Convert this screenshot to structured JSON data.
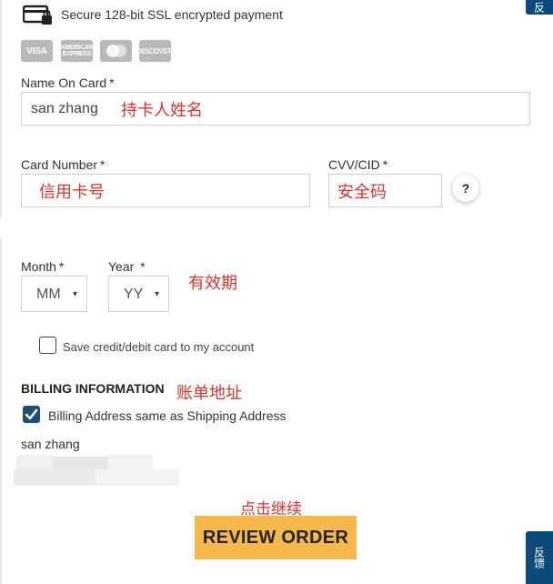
{
  "secure": {
    "text": "Secure 128-bit SSL encrypted payment"
  },
  "cards": {
    "visa": "VISA",
    "amex": "AMERICAN EXPRESS",
    "discover": "DISCOVER"
  },
  "name_on_card": {
    "label": "Name On Card",
    "required": "*",
    "value": "san zhang",
    "annotation": "持卡人姓名"
  },
  "card_number": {
    "label": "Card Number",
    "required": "*",
    "annotation": "信用卡号"
  },
  "cvv": {
    "label": "CVV/CID",
    "required": "*",
    "annotation": "安全码",
    "help": "?"
  },
  "month": {
    "label": "Month",
    "required": "*",
    "value": "MM",
    "caret": "▾"
  },
  "year": {
    "label": "Year",
    "required": "*",
    "value": "YY",
    "caret": "▾"
  },
  "expiry_annotation": "有效期",
  "save_card": {
    "label": "Save credit/debit card to my account",
    "checked": false
  },
  "billing": {
    "heading": "BILLING INFORMATION",
    "annotation": "账单地址",
    "same_as_shipping_label": "Billing Address same as Shipping Address",
    "same_as_shipping_checked": true,
    "name": "san zhang"
  },
  "review": {
    "annotation": "点击继续",
    "button_label": "REVIEW ORDER"
  },
  "side_tabs": {
    "top": "反",
    "bottom": "反馈"
  },
  "colors": {
    "accent_button": "#f7b84b",
    "checkbox_checked": "#1b4f7a",
    "annotation_red": "#e0312c",
    "side_tab": "#0b4a79"
  }
}
